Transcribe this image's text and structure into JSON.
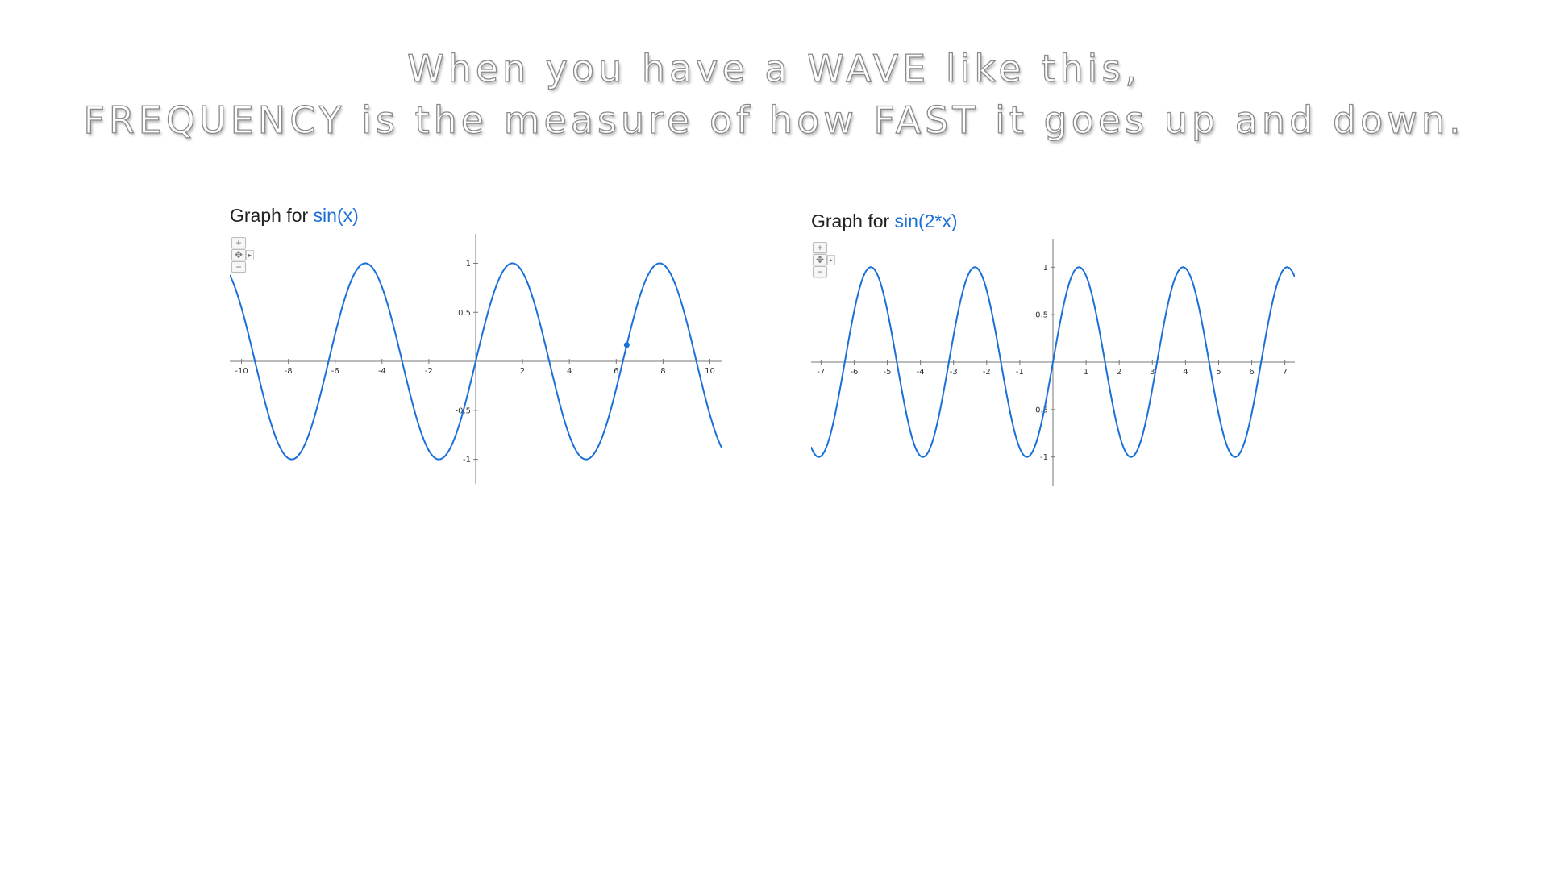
{
  "header": {
    "line1": "When you have a WAVE like this,",
    "line2": "FREQUENCY is the measure of how FAST it goes up and down."
  },
  "controls": {
    "zoom_in": "+",
    "pan": "✥",
    "zoom_out": "−",
    "expand": "▸"
  },
  "colors": {
    "curve": "#1a6fd8",
    "axis": "#777777",
    "title_function": "#1a6fd8"
  },
  "chart_data": [
    {
      "type": "line",
      "title_prefix": "Graph for ",
      "title_function": "sin(x)",
      "function": "sin(x)",
      "xlim": [
        -10.5,
        10.5
      ],
      "ylim": [
        -1.25,
        1.3
      ],
      "x_ticks": [
        "-10",
        "-8",
        "-6",
        "-4",
        "-2",
        "2",
        "4",
        "6",
        "8",
        "10"
      ],
      "y_ticks": [
        "1",
        "0.5",
        "-0.5",
        "-1"
      ],
      "highlight_point": {
        "x": 6.45,
        "y": 0.167
      },
      "grid": false
    },
    {
      "type": "line",
      "title_prefix": "Graph for ",
      "title_function": "sin(2*x)",
      "function": "sin(2*x)",
      "xlim": [
        -7.3,
        7.3
      ],
      "ylim": [
        -1.3,
        1.3
      ],
      "x_ticks": [
        "-7",
        "-6",
        "-5",
        "-4",
        "-3",
        "-2",
        "-1",
        "1",
        "2",
        "3",
        "4",
        "5",
        "6",
        "7"
      ],
      "y_ticks": [
        "1",
        "0.5",
        "-0.5",
        "-1"
      ],
      "grid": false
    }
  ]
}
